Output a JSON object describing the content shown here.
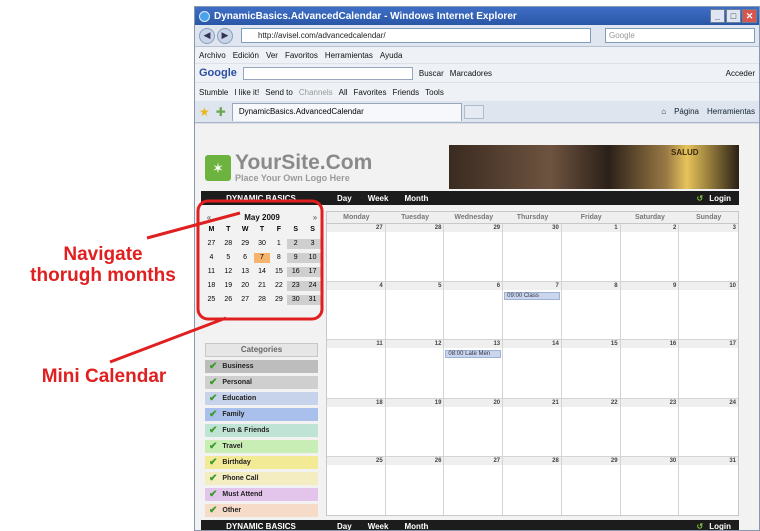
{
  "annotations": {
    "navigate": "Navigate\nthorugh months",
    "mini": "Mini Calendar"
  },
  "browser": {
    "title": "DynamicBasics.AdvancedCalendar - Windows Internet Explorer",
    "url": "http://avisel.com/advancedcalendar/",
    "search_placeholder": "Google",
    "menu": [
      "Archivo",
      "Edición",
      "Ver",
      "Favoritos",
      "Herramientas",
      "Ayuda"
    ],
    "google_toolbar": {
      "label": "Google",
      "buscar": "Buscar",
      "marcadores": "Marcadores",
      "acceder": "Acceder"
    },
    "stumble_toolbar": {
      "stumble": "Stumble",
      "ilikeit": "I like it!",
      "sendto": "Send to",
      "channels": "Channels",
      "all": "All",
      "favorites": "Favorites",
      "friends": "Friends",
      "tools": "Tools"
    },
    "tab_label": "DynamicBasics.AdvancedCalendar",
    "tab_tools": {
      "pagina": "Página",
      "herramientas": "Herramientas"
    }
  },
  "site": {
    "logo_name": "YourSite.Com",
    "logo_tagline": "Place Your Own Logo Here",
    "banner_text": "SALUD",
    "nav": {
      "brand": "DYNAMIC BASICS",
      "day": "Day",
      "week": "Week",
      "month": "Month",
      "login": "Login"
    }
  },
  "minical": {
    "prev": "«",
    "next": "»",
    "title": "May 2009",
    "day_names": [
      "M",
      "T",
      "W",
      "T",
      "F",
      "S",
      "S"
    ],
    "weeks": [
      [
        "27",
        "28",
        "29",
        "30",
        "1",
        "2",
        "3"
      ],
      [
        "4",
        "5",
        "6",
        "7",
        "8",
        "9",
        "10"
      ],
      [
        "11",
        "12",
        "13",
        "14",
        "15",
        "16",
        "17"
      ],
      [
        "18",
        "19",
        "20",
        "21",
        "22",
        "23",
        "24"
      ],
      [
        "25",
        "26",
        "27",
        "28",
        "29",
        "30",
        "31"
      ]
    ],
    "today": "7"
  },
  "categories": {
    "title": "Categories",
    "items": [
      {
        "label": "Business",
        "color": "#bdbdbd"
      },
      {
        "label": "Personal",
        "color": "#cfcfcf"
      },
      {
        "label": "Education",
        "color": "#c6d3ea"
      },
      {
        "label": "Family",
        "color": "#a9c0ec"
      },
      {
        "label": "Fun & Friends",
        "color": "#bfe3d4"
      },
      {
        "label": "Travel",
        "color": "#c9eeb5"
      },
      {
        "label": "Birthday",
        "color": "#f3ea96"
      },
      {
        "label": "Phone Call",
        "color": "#f4edc2"
      },
      {
        "label": "Must Attend",
        "color": "#e3c5ec"
      },
      {
        "label": "Other",
        "color": "#f6dcc8"
      }
    ]
  },
  "maincal": {
    "day_names": [
      "Monday",
      "Tuesday",
      "Wednesday",
      "Thursday",
      "Friday",
      "Saturday",
      "Sunday"
    ],
    "weeks": [
      [
        "27",
        "28",
        "29",
        "30",
        "1",
        "2",
        "3"
      ],
      [
        "4",
        "5",
        "6",
        "7",
        "8",
        "9",
        "10"
      ],
      [
        "11",
        "12",
        "13",
        "14",
        "15",
        "16",
        "17"
      ],
      [
        "18",
        "19",
        "20",
        "21",
        "22",
        "23",
        "24"
      ],
      [
        "25",
        "26",
        "27",
        "28",
        "29",
        "30",
        "31"
      ]
    ],
    "events": [
      {
        "week": 1,
        "day": 3,
        "label": "09:00 Class"
      },
      {
        "week": 2,
        "day": 2,
        "label": "08:00 Late Men"
      }
    ]
  }
}
